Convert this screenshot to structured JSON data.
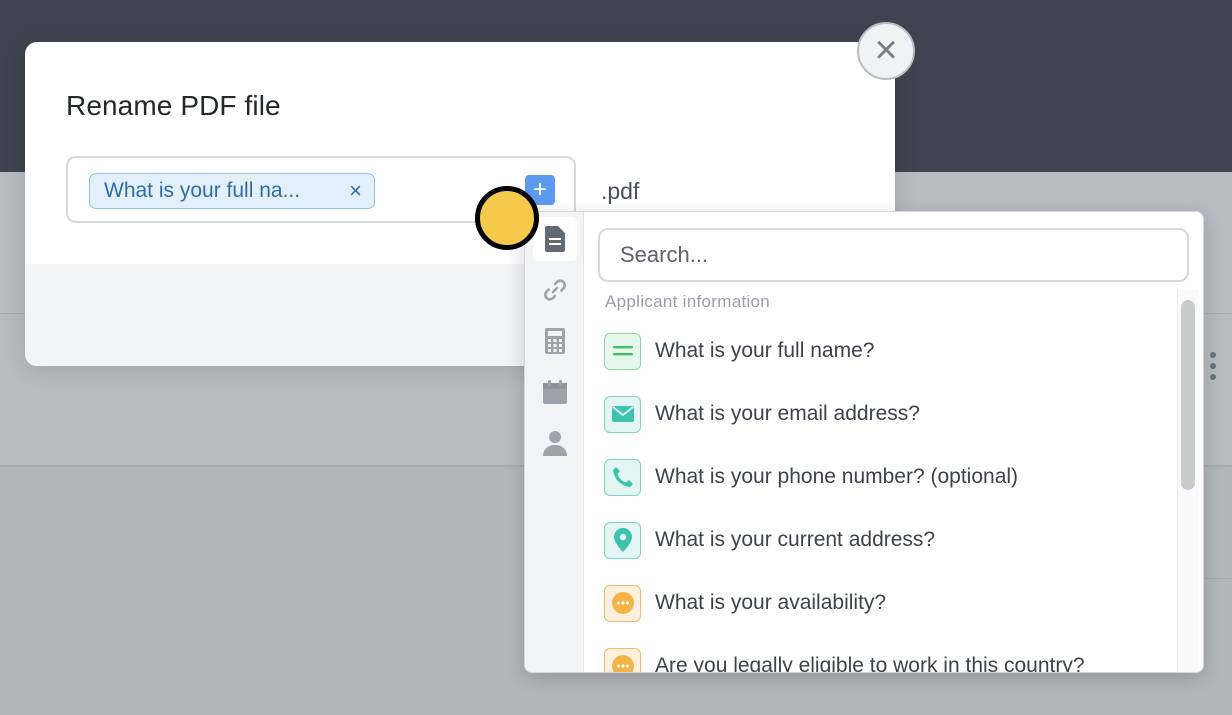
{
  "modal": {
    "title": "Rename PDF file",
    "chip_label": "What is your full na...",
    "chip_remove": "×",
    "add_symbol": "+",
    "extension": ".pdf",
    "close_symbol": "×"
  },
  "dropdown": {
    "search_placeholder": "Search...",
    "group_label": "Applicant information",
    "rail": [
      "document-icon",
      "link-icon",
      "calculator-icon",
      "calendar-icon",
      "person-icon"
    ],
    "items": [
      {
        "label": "What is your full name?",
        "icon": "short-text-icon",
        "color": "#3fbf6a"
      },
      {
        "label": "What is your email address?",
        "icon": "email-icon",
        "color": "#3cc2ad"
      },
      {
        "label": "What is your phone number? (optional)",
        "icon": "phone-icon",
        "color": "#3cc2ad"
      },
      {
        "label": "What is your current address?",
        "icon": "location-pin-icon",
        "color": "#3cc2ad"
      },
      {
        "label": "What is your availability?",
        "icon": "ellipsis-icon",
        "color": "#f0ac3a"
      },
      {
        "label": "Are you legally eligible to work in this country?",
        "icon": "ellipsis-icon",
        "color": "#f0ac3a"
      }
    ]
  },
  "colors": {
    "accent": "#5b9af0",
    "chip_bg": "#e3f0fb",
    "chip_text": "#2d6ea8",
    "cursor": "#f5c949"
  }
}
